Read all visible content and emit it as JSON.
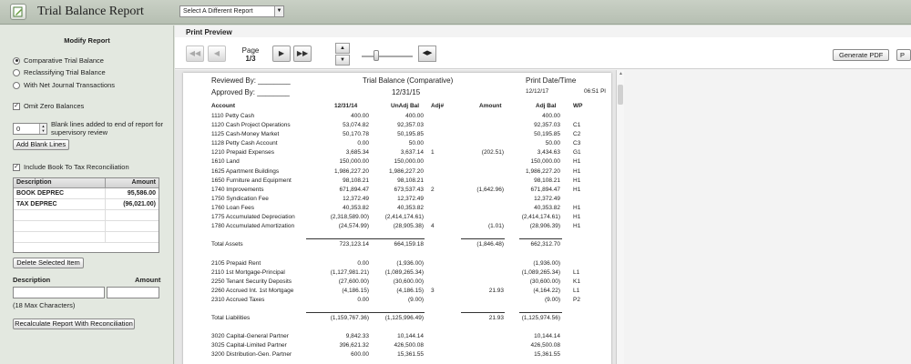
{
  "header": {
    "title": "Trial Balance Report",
    "report_select": "Select A Different Report"
  },
  "sidebar": {
    "heading": "Modify Report",
    "radios": [
      "Comparative Trial Balance",
      "Reclassifying Trial Balance",
      "With Net Journal Transactions"
    ],
    "omit_zero": "Omit Zero Balances",
    "blank_lines_value": "0",
    "blank_lines_label": "Blank lines added to end of report for supervisory review",
    "add_blank_button": "Add Blank Lines",
    "include_recon": "Include Book To Tax Reconciliation",
    "table_header": {
      "description": "Description",
      "amount": "Amount"
    },
    "table_rows": [
      {
        "description": "BOOK DEPREC",
        "amount": "95,586.00"
      },
      {
        "description": "TAX DEPREC",
        "amount": "(96,021.00)"
      }
    ],
    "delete_button": "Delete Selected Item",
    "desc_label": "Description",
    "amount_label": "Amount",
    "max_chars": "(18 Max Characters)",
    "recalc_button": "Recalculate Report With Reconciliation"
  },
  "preview": {
    "title": "Print Preview",
    "page_label": "Page",
    "page_value": "1/3",
    "generate_pdf": "Generate PDF",
    "print_button": "P"
  },
  "report": {
    "reviewed_by": "Reviewed By: ________",
    "approved_by": "Approved By: ________",
    "title": "Trial Balance (Comparative)",
    "date": "12/31/15",
    "print_label": "Print Date/Time",
    "print_date": "12/12/17",
    "print_time": "06:51 Pl",
    "columns": [
      "Account",
      "12/31/14",
      "UnAdj Bal",
      "Adj#",
      "Amount",
      "Adj Bal",
      "WP"
    ],
    "rows": [
      [
        "1110  Petty Cash",
        "400.00",
        "400.00",
        "",
        "",
        "400.00",
        ""
      ],
      [
        "1120  Cash Project Operations",
        "53,074.82",
        "92,357.03",
        "",
        "",
        "92,357.03",
        "C1"
      ],
      [
        "1125  Cash-Money Market",
        "50,170.78",
        "50,195.85",
        "",
        "",
        "50,195.85",
        "C2"
      ],
      [
        "1128  Petty Cash Account",
        "0.00",
        "50.00",
        "",
        "",
        "50.00",
        "C3"
      ],
      [
        "1210  Prepaid Expenses",
        "3,685.34",
        "3,637.14",
        "1",
        "(202.51)",
        "3,434.63",
        "G1"
      ],
      [
        "1610  Land",
        "150,000.00",
        "150,000.00",
        "",
        "",
        "150,000.00",
        "H1"
      ],
      [
        "1625  Apartment Buildings",
        "1,986,227.20",
        "1,986,227.20",
        "",
        "",
        "1,986,227.20",
        "H1"
      ],
      [
        "1650  Furniture and Equipment",
        "98,108.21",
        "98,108.21",
        "",
        "",
        "98,108.21",
        "H1"
      ],
      [
        "1740  Improvements",
        "671,894.47",
        "673,537.43",
        "2",
        "(1,642.96)",
        "671,894.47",
        "H1"
      ],
      [
        "1750  Syndication Fee",
        "12,372.49",
        "12,372.49",
        "",
        "",
        "12,372.49",
        ""
      ],
      [
        "1760  Loan Fees",
        "40,353.82",
        "40,353.82",
        "",
        "",
        "40,353.82",
        "H1"
      ],
      [
        "1775  Accumulated Depreciation",
        "(2,318,589.00)",
        "(2,414,174.61)",
        "",
        "",
        "(2,414,174.61)",
        "H1"
      ],
      [
        "1780  Accumulated Amortization",
        "(24,574.99)",
        "(28,905.38)",
        "4",
        "(1.01)",
        "(28,906.39)",
        "H1"
      ],
      [
        "",
        "",
        "",
        "",
        "",
        "",
        ""
      ],
      [
        "      Total Assets",
        "723,123.14",
        "664,159.18",
        "",
        "(1,846.48)",
        "662,312.70",
        ""
      ],
      [
        "",
        "",
        "",
        "",
        "",
        "",
        ""
      ],
      [
        "2105  Prepaid Rent",
        "0.00",
        "(1,936.00)",
        "",
        "",
        "(1,936.00)",
        ""
      ],
      [
        "2110  1st Mortgage-Principal",
        "(1,127,981.21)",
        "(1,089,265.34)",
        "",
        "",
        "(1,089,265.34)",
        "L1"
      ],
      [
        "2250  Tenant Security Deposits",
        "(27,600.00)",
        "(30,600.00)",
        "",
        "",
        "(30,600.00)",
        "K1"
      ],
      [
        "2260  Accrued Int. 1st Mortgage",
        "(4,186.15)",
        "(4,186.15)",
        "3",
        "21.93",
        "(4,164.22)",
        "L1"
      ],
      [
        "2310  Accrued Taxes",
        "0.00",
        "(9.00)",
        "",
        "",
        "(9.00)",
        "P2"
      ],
      [
        "",
        "",
        "",
        "",
        "",
        "",
        ""
      ],
      [
        "      Total Liabilities",
        "(1,159,767.36)",
        "(1,125,996.49)",
        "",
        "21.93",
        "(1,125,974.56)",
        ""
      ],
      [
        "",
        "",
        "",
        "",
        "",
        "",
        ""
      ],
      [
        "3020  Capital-General Partner",
        "9,842.33",
        "10,144.14",
        "",
        "",
        "10,144.14",
        ""
      ],
      [
        "3025  Capital-Limited Partner",
        "396,621.32",
        "426,500.08",
        "",
        "",
        "426,500.08",
        ""
      ],
      [
        "3200  Distribution-Gen. Partner",
        "600.00",
        "15,361.55",
        "",
        "",
        "15,361.55",
        ""
      ]
    ]
  }
}
